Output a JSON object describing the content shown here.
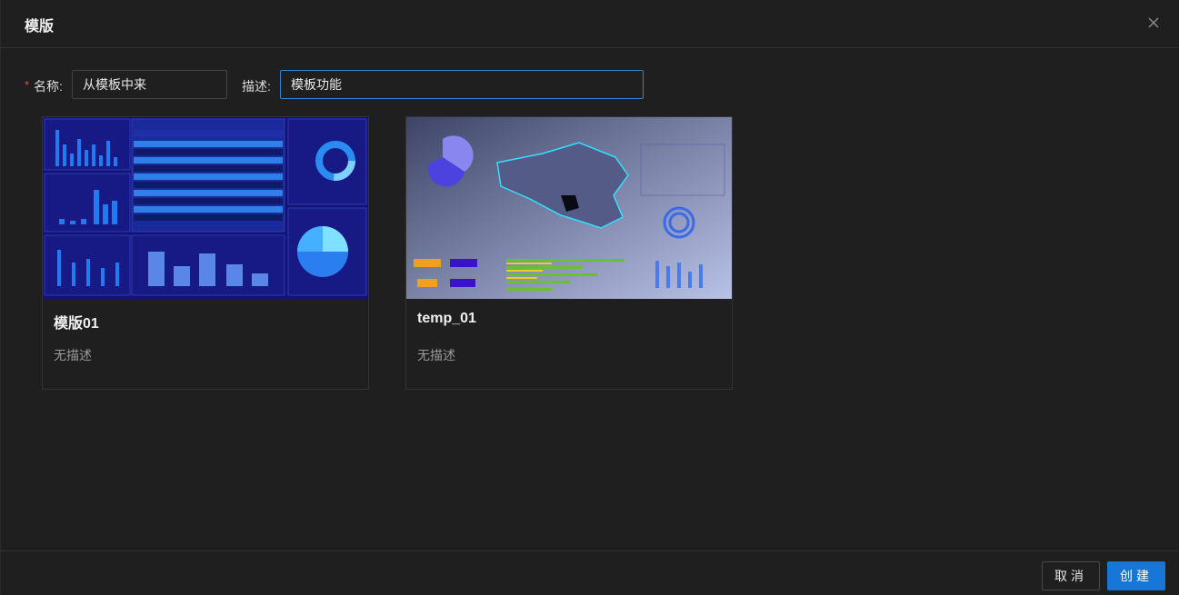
{
  "dialog": {
    "title": "模版",
    "close_icon": "close-icon"
  },
  "form": {
    "required_mark": "*",
    "name_label": "名称:",
    "name_value": "从模板中来",
    "desc_label": "描述:",
    "desc_value": "模板功能"
  },
  "templates": [
    {
      "title": "模版01",
      "description": "无描述"
    },
    {
      "title": "temp_01",
      "description": "无描述"
    }
  ],
  "footer": {
    "cancel_label": "取消",
    "create_label": "创建"
  },
  "colors": {
    "background": "#1f1f20",
    "accent": "#1677d8",
    "required": "#e5484d"
  }
}
